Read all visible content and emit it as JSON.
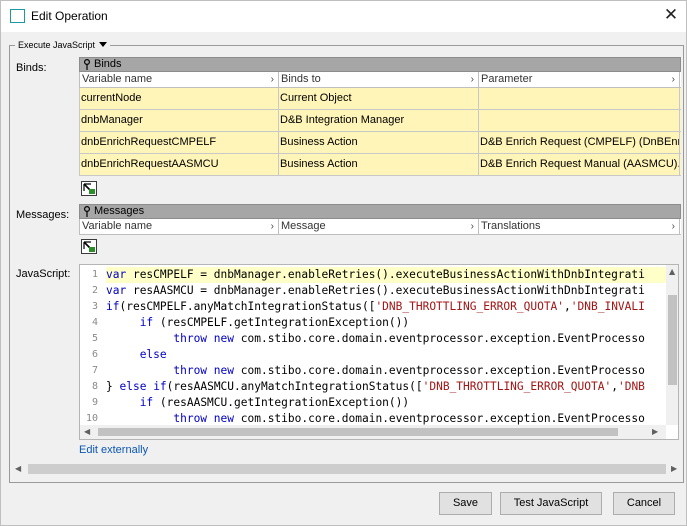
{
  "window": {
    "title": "Edit Operation",
    "close_glyph": "✕"
  },
  "panel": {
    "tab_label": "Execute JavaScript"
  },
  "binds": {
    "field_label": "Binds:",
    "group_title": "Binds",
    "columns": [
      "Variable name",
      "Binds to",
      "Parameter"
    ],
    "rows": [
      [
        "currentNode",
        "Current Object",
        ""
      ],
      [
        "dnbManager",
        "D&B Integration Manager",
        ""
      ],
      [
        "dnbEnrichRequestCMPELF",
        "Business Action",
        "D&B Enrich Request (CMPELF) (DnBEnr..."
      ],
      [
        "dnbEnrichRequestAASMCU",
        "Business Action",
        "D&B Enrich Request Manual (AASMCU)..."
      ]
    ],
    "row_color": "#fff5b8"
  },
  "messages": {
    "field_label": "Messages:",
    "group_title": "Messages",
    "columns": [
      "Variable name",
      "Message",
      "Translations"
    ]
  },
  "javascript": {
    "field_label": "JavaScript:",
    "line_numbers": [
      "1",
      "2",
      "3",
      "4",
      "5",
      "6",
      "7",
      "8",
      "9",
      "10"
    ],
    "lines": [
      "var resCMPELF = dnbManager.enableRetries().executeBusinessActionWithDnbIntegrati",
      "var resAASMCU = dnbManager.enableRetries().executeBusinessActionWithDnbIntegrati",
      "if(resCMPELF.anyMatchIntegrationStatus(['DNB_THROTTLING_ERROR_QUOTA','DNB_INVALI",
      "     if (resCMPELF.getIntegrationException())",
      "          throw new com.stibo.core.domain.eventprocessor.exception.EventProcesso",
      "     else",
      "          throw new com.stibo.core.domain.eventprocessor.exception.EventProcesso",
      "} else if(resAASMCU.anyMatchIntegrationStatus(['DNB_THROTTLING_ERROR_QUOTA','DNB",
      "     if (resAASMCU.getIntegrationException())",
      "          throw new com.stibo.core.domain.eventprocessor.exception.EventProcesso"
    ],
    "edit_externally": "Edit externally"
  },
  "buttons": {
    "save": "Save",
    "test": "Test JavaScript",
    "cancel": "Cancel"
  },
  "icons": {
    "app": "edit-operation-icon",
    "pin": "pin-icon",
    "add": "add-row-icon"
  }
}
